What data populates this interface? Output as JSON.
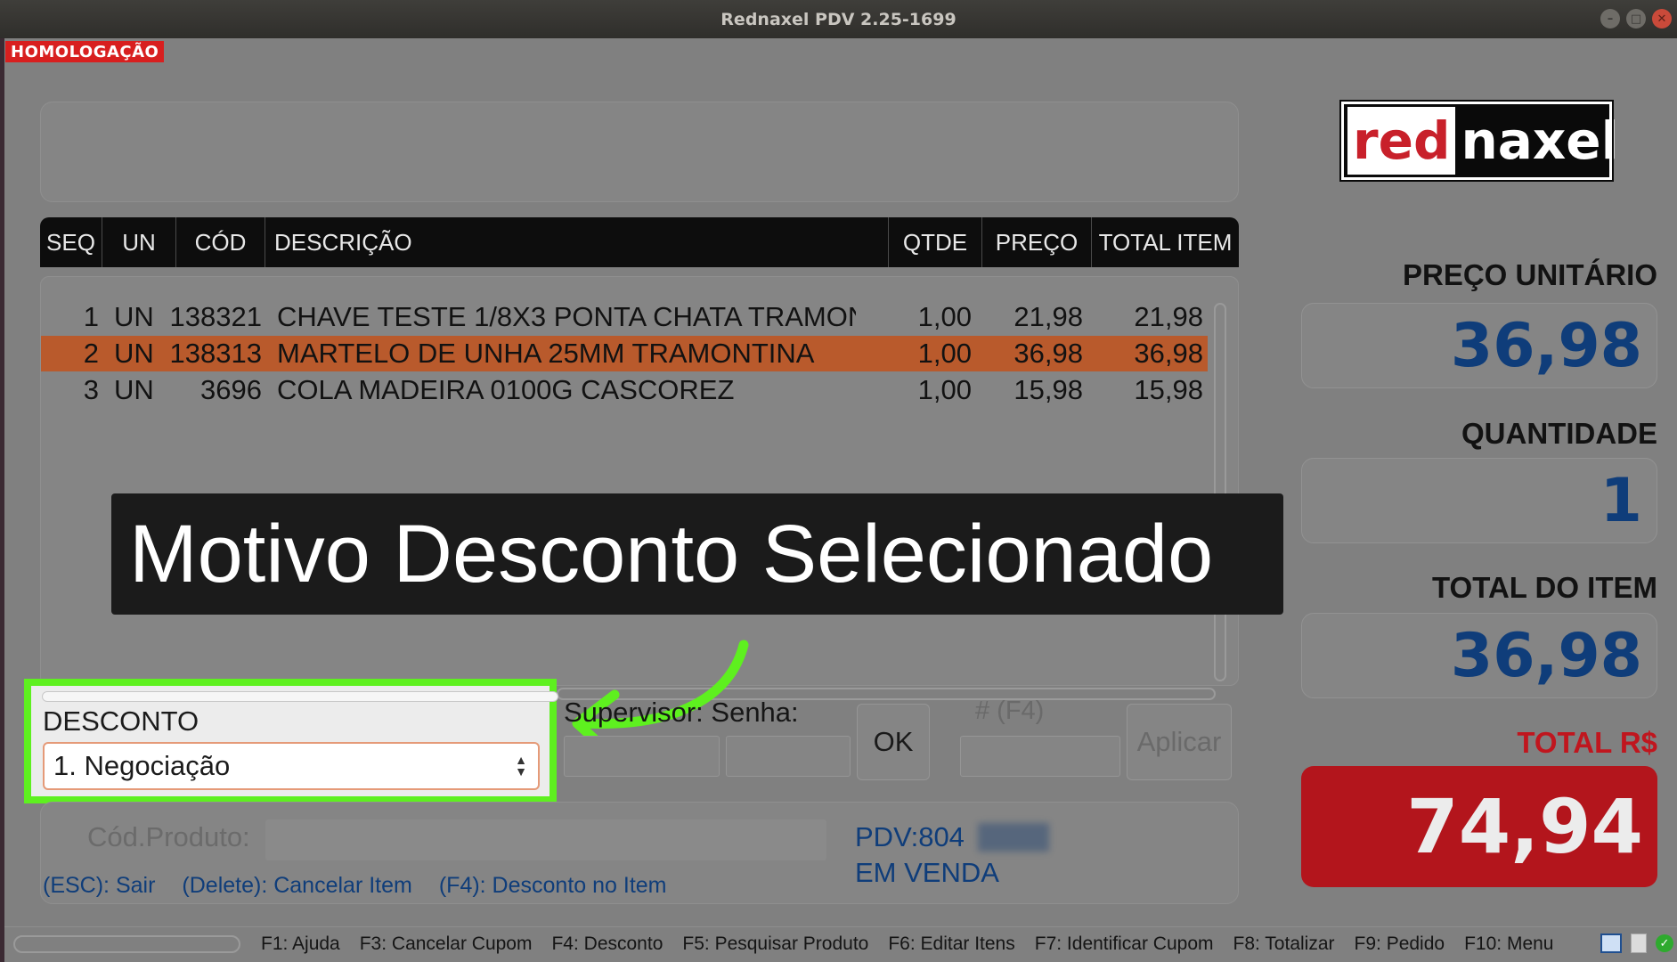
{
  "window": {
    "title": "Rednaxel PDV 2.25-1699"
  },
  "env_badge": "HOMOLOGAÇÃO",
  "table": {
    "headers": [
      "SEQ",
      "UN",
      "CÓD",
      "DESCRIÇÃO",
      "QTDE",
      "PREÇO",
      "TOTAL ITEM"
    ],
    "rows": [
      {
        "seq": "1",
        "un": "UN",
        "cod": "138321",
        "desc": "CHAVE TESTE 1/8X3 PONTA CHATA TRAMON",
        "qtde": "1,00",
        "preco": "21,98",
        "total": "21,98"
      },
      {
        "seq": "2",
        "un": "UN",
        "cod": "138313",
        "desc": "MARTELO DE UNHA 25MM TRAMONTINA",
        "qtde": "1,00",
        "preco": "36,98",
        "total": "36,98"
      },
      {
        "seq": "3",
        "un": "UN",
        "cod": "3696",
        "desc": "COLA MADEIRA 0100G CASCOREZ",
        "qtde": "1,00",
        "preco": "15,98",
        "total": "15,98"
      }
    ],
    "selected_row": 2
  },
  "banner_text": "Motivo Desconto Selecionado",
  "discount": {
    "label": "DESCONTO",
    "selected": "1. Negociação",
    "supervisor_label": "Supervisor: Senha:",
    "ok_label": "OK",
    "hash_label": "#   (F4)",
    "apply_label": "Aplicar"
  },
  "product": {
    "cod_label": "Cód.Produto:",
    "pdv": "PDV:804",
    "status": "EM VENDA"
  },
  "hints": [
    "(ESC): Sair",
    "(Delete): Cancelar Item",
    "(F4): Desconto no Item"
  ],
  "logo": {
    "part1": "red",
    "part2": "naxel"
  },
  "summary": {
    "unit_price_label": "PREÇO UNITÁRIO",
    "unit_price": "36,98",
    "qty_label": "QUANTIDADE",
    "qty": "1",
    "item_total_label": "TOTAL DO ITEM",
    "item_total": "36,98",
    "total_label": "TOTAL R$",
    "total": "74,94"
  },
  "fkeys": [
    "F1: Ajuda",
    "F3: Cancelar Cupom",
    "F4: Desconto",
    "F5: Pesquisar Produto",
    "F6: Editar Itens",
    "F7: Identificar Cupom",
    "F8: Totalizar",
    "F9: Pedido",
    "F10: Menu"
  ],
  "colors": {
    "accent_highlight": "#5ef01f",
    "selected_row": "#b95a2c",
    "total_red": "#b3151c",
    "value_blue": "#0f3d7a"
  }
}
